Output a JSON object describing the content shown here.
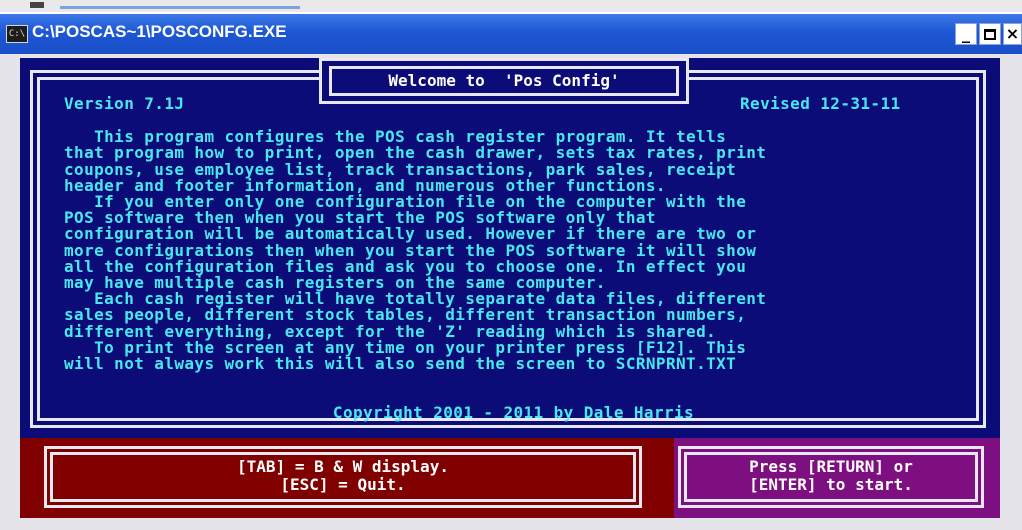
{
  "window": {
    "title": "C:\\POSCAS~1\\POSCONFG.EXE",
    "icon_label": "C:\\",
    "minimize_symbol": "_",
    "close_symbol": "×"
  },
  "screen": {
    "welcome_title": "Welcome to  'Pos Config'",
    "version": "Version 7.1J",
    "revised": "Revised 12-31-11",
    "body_lines": [
      "   This program configures the POS cash register program. It tells",
      "that program how to print, open the cash drawer, sets tax rates, print",
      "coupons, use employee list, track transactions, park sales, receipt",
      "header and footer information, and numerous other functions.",
      "   If you enter only one configuration file on the computer with the",
      "POS software then when you start the POS software only that",
      "configuration will be automatically used. However if there are two or",
      "more configurations then when you start the POS software it will show",
      "all the configuration files and ask you to choose one. In effect you",
      "may have multiple cash registers on the same computer.",
      "   Each cash register will have totally separate data files, different",
      "sales people, different stock tables, different transaction numbers,",
      "different everything, except for the 'Z' reading which is shared.",
      "   To print the screen at any time on your printer press [F12]. This",
      "will not always work this will also send the screen to SCRNPRNT.TXT"
    ],
    "copyright": "Copyright 2001 - 2011 by Dale Harris"
  },
  "keys": {
    "tab_line": "[TAB] = B & W display.",
    "esc_line": "[ESC] = Quit."
  },
  "start": {
    "line1": "Press [RETURN] or",
    "line2": "[ENTER] to start."
  },
  "colors": {
    "console_blue": "#0c0c78",
    "text_cyan": "#48e8f0",
    "key_panel_red": "#800000",
    "start_panel_purple": "#7e0f80",
    "titlebar_blue": "#1d57d4"
  }
}
